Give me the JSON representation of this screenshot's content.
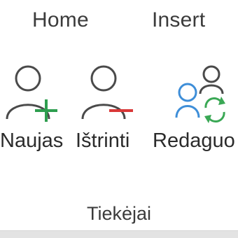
{
  "tabs": [
    {
      "label": "Home"
    },
    {
      "label": "Insert"
    }
  ],
  "group": {
    "label": "Tiekėjai",
    "commands": [
      {
        "label": "Naujas",
        "icon": "add-user-icon"
      },
      {
        "label": "Ištrinti",
        "icon": "remove-user-icon"
      },
      {
        "label": "Redaguo",
        "icon": "sync-users-icon"
      }
    ]
  },
  "colors": {
    "text": "#2b2b2b",
    "icon_outline": "#4a4a4a",
    "add_green": "#2e9e4f",
    "remove_red": "#d93838",
    "user_blue": "#3e8ed8",
    "sync_green": "#3aa855",
    "bottom_bar": "#e3e3e3"
  }
}
